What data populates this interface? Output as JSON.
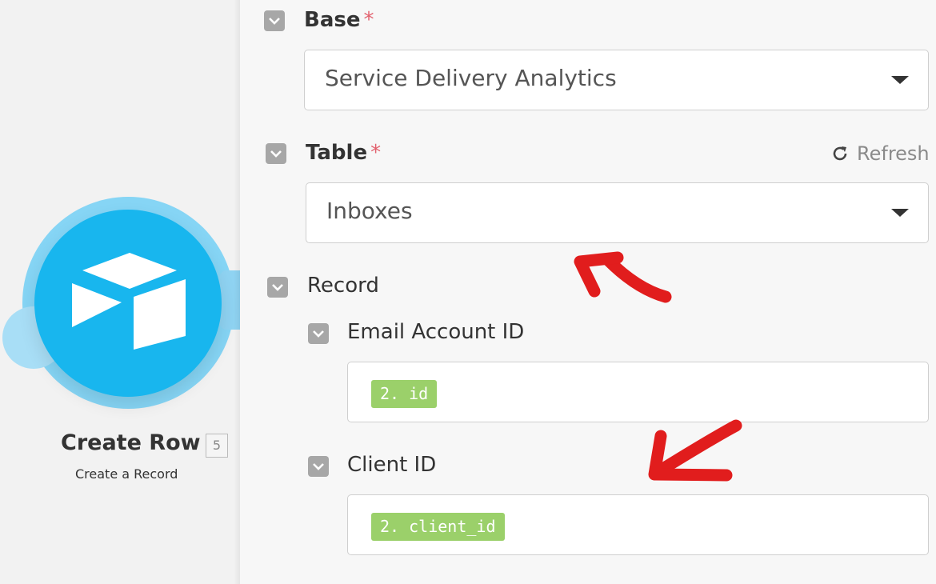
{
  "module": {
    "title": "Create Row",
    "badge": "5",
    "subtitle": "Create a Record",
    "icon": "airtable-icon",
    "color": "#18b6ee"
  },
  "form": {
    "base": {
      "label": "Base",
      "required_mark": "*",
      "value": "Service Delivery Analytics"
    },
    "table": {
      "label": "Table",
      "required_mark": "*",
      "value": "Inboxes",
      "refresh_label": "Refresh"
    },
    "record": {
      "label": "Record",
      "fields": [
        {
          "label": "Email Account ID",
          "pill": "2. id"
        },
        {
          "label": "Client ID",
          "pill": "2. client_id"
        }
      ]
    }
  },
  "colors": {
    "pill": "#9bd06a",
    "required": "#e2616e",
    "annotation": "#e11d1d"
  }
}
